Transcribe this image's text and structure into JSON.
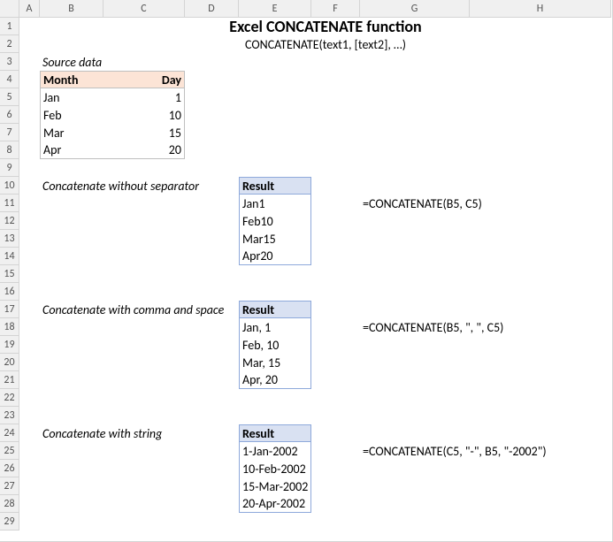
{
  "columns": [
    "A",
    "B",
    "C",
    "D",
    "E",
    "F",
    "G",
    "H"
  ],
  "rows": [
    "1",
    "2",
    "3",
    "4",
    "5",
    "6",
    "7",
    "8",
    "9",
    "10",
    "11",
    "12",
    "13",
    "14",
    "15",
    "16",
    "17",
    "18",
    "19",
    "20",
    "21",
    "22",
    "23",
    "24",
    "25",
    "26",
    "27",
    "28",
    "29"
  ],
  "title": "Excel CONCATENATE function",
  "syntax": "CONCATENATE(text1, [text2], …)",
  "source": {
    "label": "Source data",
    "headers": {
      "month": "Month",
      "day": "Day"
    },
    "rows": [
      {
        "month": "Jan",
        "day": "1"
      },
      {
        "month": "Feb",
        "day": "10"
      },
      {
        "month": "Mar",
        "day": "15"
      },
      {
        "month": "Apr",
        "day": "20"
      }
    ]
  },
  "examples": [
    {
      "label": "Concatenate without separator",
      "header": "Result",
      "results": [
        "Jan1",
        "Feb10",
        "Mar15",
        "Apr20"
      ],
      "formula": "=CONCATENATE(B5, C5)"
    },
    {
      "label": "Concatenate with comma and space",
      "header": "Result",
      "results": [
        "Jan, 1",
        "Feb, 10",
        "Mar, 15",
        "Apr, 20"
      ],
      "formula": "=CONCATENATE(B5, \", \",  C5)"
    },
    {
      "label": "Concatenate with string",
      "header": "Result",
      "results": [
        "1-Jan-2002",
        "10-Feb-2002",
        "15-Mar-2002",
        "20-Apr-2002"
      ],
      "formula": "=CONCATENATE(C5, \"-\", B5, \"-2002\")"
    }
  ]
}
